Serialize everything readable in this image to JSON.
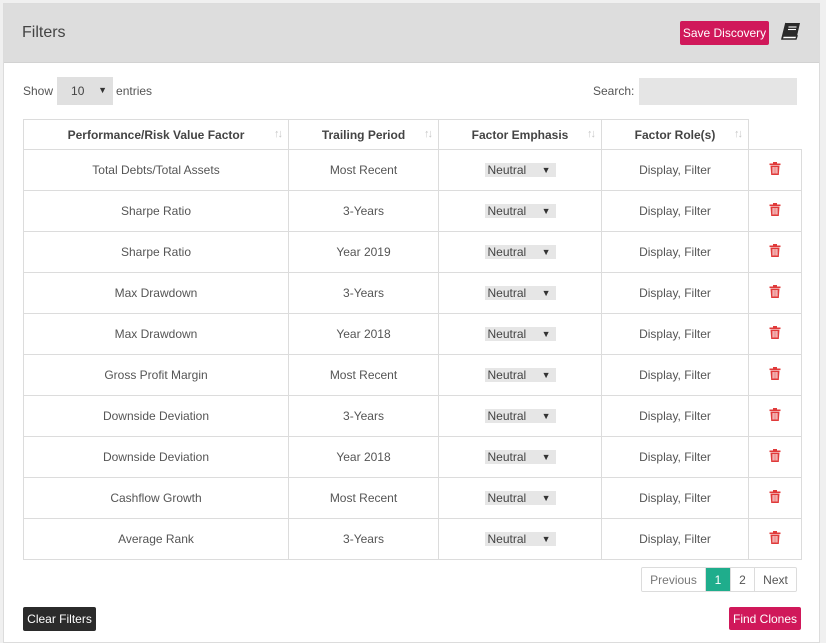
{
  "header": {
    "title": "Filters",
    "save_label": "Save Discovery",
    "book_icon": "book-icon"
  },
  "length_control": {
    "show_label": "Show",
    "value": "10",
    "entries_label": "entries"
  },
  "search": {
    "label": "Search:",
    "value": ""
  },
  "table": {
    "columns": [
      "Performance/Risk Value Factor",
      "Trailing Period",
      "Factor Emphasis",
      "Factor Role(s)"
    ],
    "rows": [
      {
        "factor": "Total Debts/Total Assets",
        "period": "Most Recent",
        "emphasis": "Neutral",
        "role": "Display, Filter"
      },
      {
        "factor": "Sharpe Ratio",
        "period": "3-Years",
        "emphasis": "Neutral",
        "role": "Display, Filter"
      },
      {
        "factor": "Sharpe Ratio",
        "period": "Year 2019",
        "emphasis": "Neutral",
        "role": "Display, Filter"
      },
      {
        "factor": "Max Drawdown",
        "period": "3-Years",
        "emphasis": "Neutral",
        "role": "Display, Filter"
      },
      {
        "factor": "Max Drawdown",
        "period": "Year 2018",
        "emphasis": "Neutral",
        "role": "Display, Filter"
      },
      {
        "factor": "Gross Profit Margin",
        "period": "Most Recent",
        "emphasis": "Neutral",
        "role": "Display, Filter"
      },
      {
        "factor": "Downside Deviation",
        "period": "3-Years",
        "emphasis": "Neutral",
        "role": "Display, Filter"
      },
      {
        "factor": "Downside Deviation",
        "period": "Year 2018",
        "emphasis": "Neutral",
        "role": "Display, Filter"
      },
      {
        "factor": "Cashflow Growth",
        "period": "Most Recent",
        "emphasis": "Neutral",
        "role": "Display, Filter"
      },
      {
        "factor": "Average Rank",
        "period": "3-Years",
        "emphasis": "Neutral",
        "role": "Display, Filter"
      }
    ]
  },
  "pagination": {
    "previous": "Previous",
    "pages": [
      "1",
      "2"
    ],
    "active": "1",
    "next": "Next"
  },
  "footer": {
    "clear_label": "Clear Filters",
    "clones_label": "Find Clones"
  },
  "colors": {
    "accent": "#d0185a",
    "active_page": "#1fad8c",
    "trash": "#e03a3a",
    "dark_button": "#2b2b2b",
    "header_bg": "#dddddd"
  }
}
